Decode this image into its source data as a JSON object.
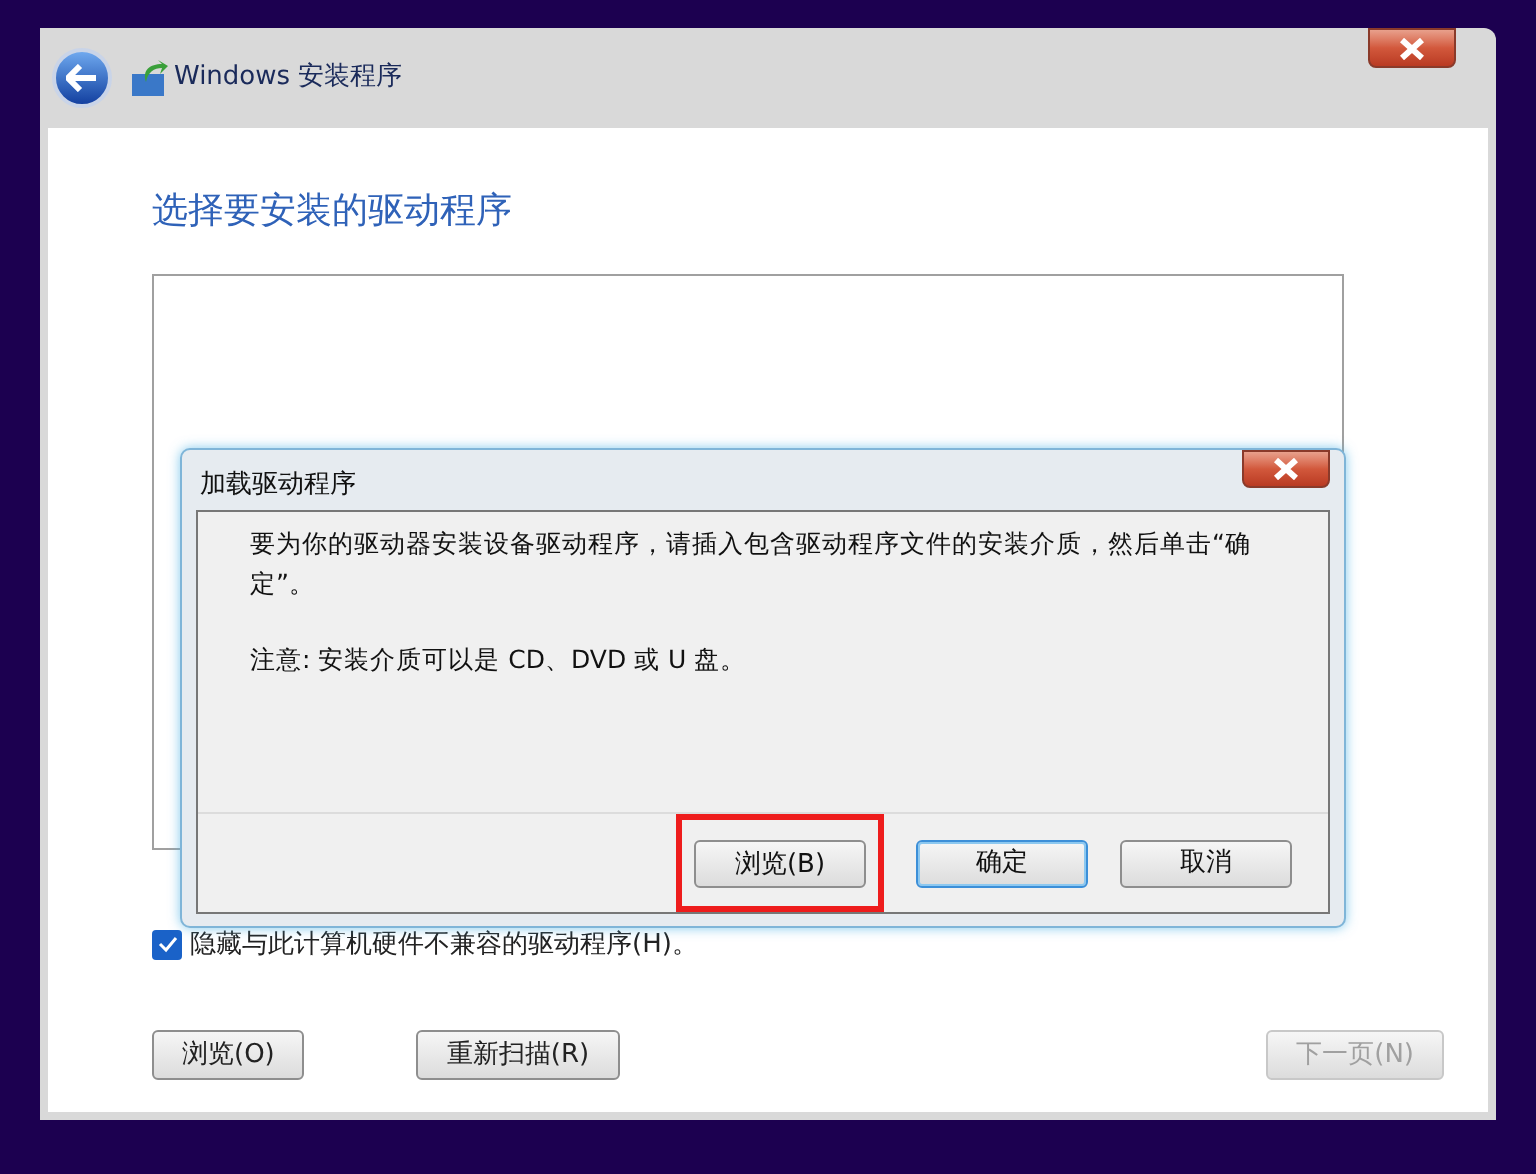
{
  "window": {
    "title": "Windows 安装程序"
  },
  "heading": "选择要安装的驱动程序",
  "hide_incompatible": {
    "label": "隐藏与此计算机硬件不兼容的驱动程序(H)。",
    "checked": true
  },
  "buttons": [
    {
      "label": "浏览(O)",
      "disabled": false
    },
    {
      "label": "重新扫描(R)",
      "disabled": false
    },
    {
      "label": "下一页(N)",
      "disabled": true
    }
  ],
  "dialog": {
    "title": "加载驱动程序",
    "message": "要为你的驱动器安装设备驱动程序，请插入包含驱动程序文件的安装介质，然后单击“确定”。",
    "note": "注意: 安装介质可以是 CD、DVD 或 U 盘。",
    "buttons": [
      {
        "label": "浏览(B)",
        "default": false,
        "highlighted": true
      },
      {
        "label": "确定",
        "default": true,
        "highlighted": false
      },
      {
        "label": "取消",
        "default": false,
        "highlighted": false
      }
    ]
  }
}
